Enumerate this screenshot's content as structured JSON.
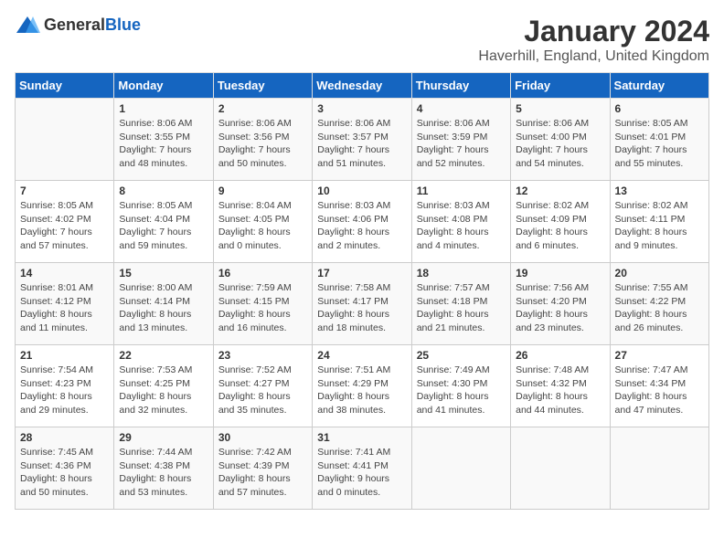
{
  "header": {
    "logo_general": "General",
    "logo_blue": "Blue",
    "month": "January 2024",
    "location": "Haverhill, England, United Kingdom"
  },
  "days_of_week": [
    "Sunday",
    "Monday",
    "Tuesday",
    "Wednesday",
    "Thursday",
    "Friday",
    "Saturday"
  ],
  "weeks": [
    [
      {
        "day": "",
        "content": ""
      },
      {
        "day": "1",
        "content": "Sunrise: 8:06 AM\nSunset: 3:55 PM\nDaylight: 7 hours\nand 48 minutes."
      },
      {
        "day": "2",
        "content": "Sunrise: 8:06 AM\nSunset: 3:56 PM\nDaylight: 7 hours\nand 50 minutes."
      },
      {
        "day": "3",
        "content": "Sunrise: 8:06 AM\nSunset: 3:57 PM\nDaylight: 7 hours\nand 51 minutes."
      },
      {
        "day": "4",
        "content": "Sunrise: 8:06 AM\nSunset: 3:59 PM\nDaylight: 7 hours\nand 52 minutes."
      },
      {
        "day": "5",
        "content": "Sunrise: 8:06 AM\nSunset: 4:00 PM\nDaylight: 7 hours\nand 54 minutes."
      },
      {
        "day": "6",
        "content": "Sunrise: 8:05 AM\nSunset: 4:01 PM\nDaylight: 7 hours\nand 55 minutes."
      }
    ],
    [
      {
        "day": "7",
        "content": "Sunrise: 8:05 AM\nSunset: 4:02 PM\nDaylight: 7 hours\nand 57 minutes."
      },
      {
        "day": "8",
        "content": "Sunrise: 8:05 AM\nSunset: 4:04 PM\nDaylight: 7 hours\nand 59 minutes."
      },
      {
        "day": "9",
        "content": "Sunrise: 8:04 AM\nSunset: 4:05 PM\nDaylight: 8 hours\nand 0 minutes."
      },
      {
        "day": "10",
        "content": "Sunrise: 8:03 AM\nSunset: 4:06 PM\nDaylight: 8 hours\nand 2 minutes."
      },
      {
        "day": "11",
        "content": "Sunrise: 8:03 AM\nSunset: 4:08 PM\nDaylight: 8 hours\nand 4 minutes."
      },
      {
        "day": "12",
        "content": "Sunrise: 8:02 AM\nSunset: 4:09 PM\nDaylight: 8 hours\nand 6 minutes."
      },
      {
        "day": "13",
        "content": "Sunrise: 8:02 AM\nSunset: 4:11 PM\nDaylight: 8 hours\nand 9 minutes."
      }
    ],
    [
      {
        "day": "14",
        "content": "Sunrise: 8:01 AM\nSunset: 4:12 PM\nDaylight: 8 hours\nand 11 minutes."
      },
      {
        "day": "15",
        "content": "Sunrise: 8:00 AM\nSunset: 4:14 PM\nDaylight: 8 hours\nand 13 minutes."
      },
      {
        "day": "16",
        "content": "Sunrise: 7:59 AM\nSunset: 4:15 PM\nDaylight: 8 hours\nand 16 minutes."
      },
      {
        "day": "17",
        "content": "Sunrise: 7:58 AM\nSunset: 4:17 PM\nDaylight: 8 hours\nand 18 minutes."
      },
      {
        "day": "18",
        "content": "Sunrise: 7:57 AM\nSunset: 4:18 PM\nDaylight: 8 hours\nand 21 minutes."
      },
      {
        "day": "19",
        "content": "Sunrise: 7:56 AM\nSunset: 4:20 PM\nDaylight: 8 hours\nand 23 minutes."
      },
      {
        "day": "20",
        "content": "Sunrise: 7:55 AM\nSunset: 4:22 PM\nDaylight: 8 hours\nand 26 minutes."
      }
    ],
    [
      {
        "day": "21",
        "content": "Sunrise: 7:54 AM\nSunset: 4:23 PM\nDaylight: 8 hours\nand 29 minutes."
      },
      {
        "day": "22",
        "content": "Sunrise: 7:53 AM\nSunset: 4:25 PM\nDaylight: 8 hours\nand 32 minutes."
      },
      {
        "day": "23",
        "content": "Sunrise: 7:52 AM\nSunset: 4:27 PM\nDaylight: 8 hours\nand 35 minutes."
      },
      {
        "day": "24",
        "content": "Sunrise: 7:51 AM\nSunset: 4:29 PM\nDaylight: 8 hours\nand 38 minutes."
      },
      {
        "day": "25",
        "content": "Sunrise: 7:49 AM\nSunset: 4:30 PM\nDaylight: 8 hours\nand 41 minutes."
      },
      {
        "day": "26",
        "content": "Sunrise: 7:48 AM\nSunset: 4:32 PM\nDaylight: 8 hours\nand 44 minutes."
      },
      {
        "day": "27",
        "content": "Sunrise: 7:47 AM\nSunset: 4:34 PM\nDaylight: 8 hours\nand 47 minutes."
      }
    ],
    [
      {
        "day": "28",
        "content": "Sunrise: 7:45 AM\nSunset: 4:36 PM\nDaylight: 8 hours\nand 50 minutes."
      },
      {
        "day": "29",
        "content": "Sunrise: 7:44 AM\nSunset: 4:38 PM\nDaylight: 8 hours\nand 53 minutes."
      },
      {
        "day": "30",
        "content": "Sunrise: 7:42 AM\nSunset: 4:39 PM\nDaylight: 8 hours\nand 57 minutes."
      },
      {
        "day": "31",
        "content": "Sunrise: 7:41 AM\nSunset: 4:41 PM\nDaylight: 9 hours\nand 0 minutes."
      },
      {
        "day": "",
        "content": ""
      },
      {
        "day": "",
        "content": ""
      },
      {
        "day": "",
        "content": ""
      }
    ]
  ]
}
